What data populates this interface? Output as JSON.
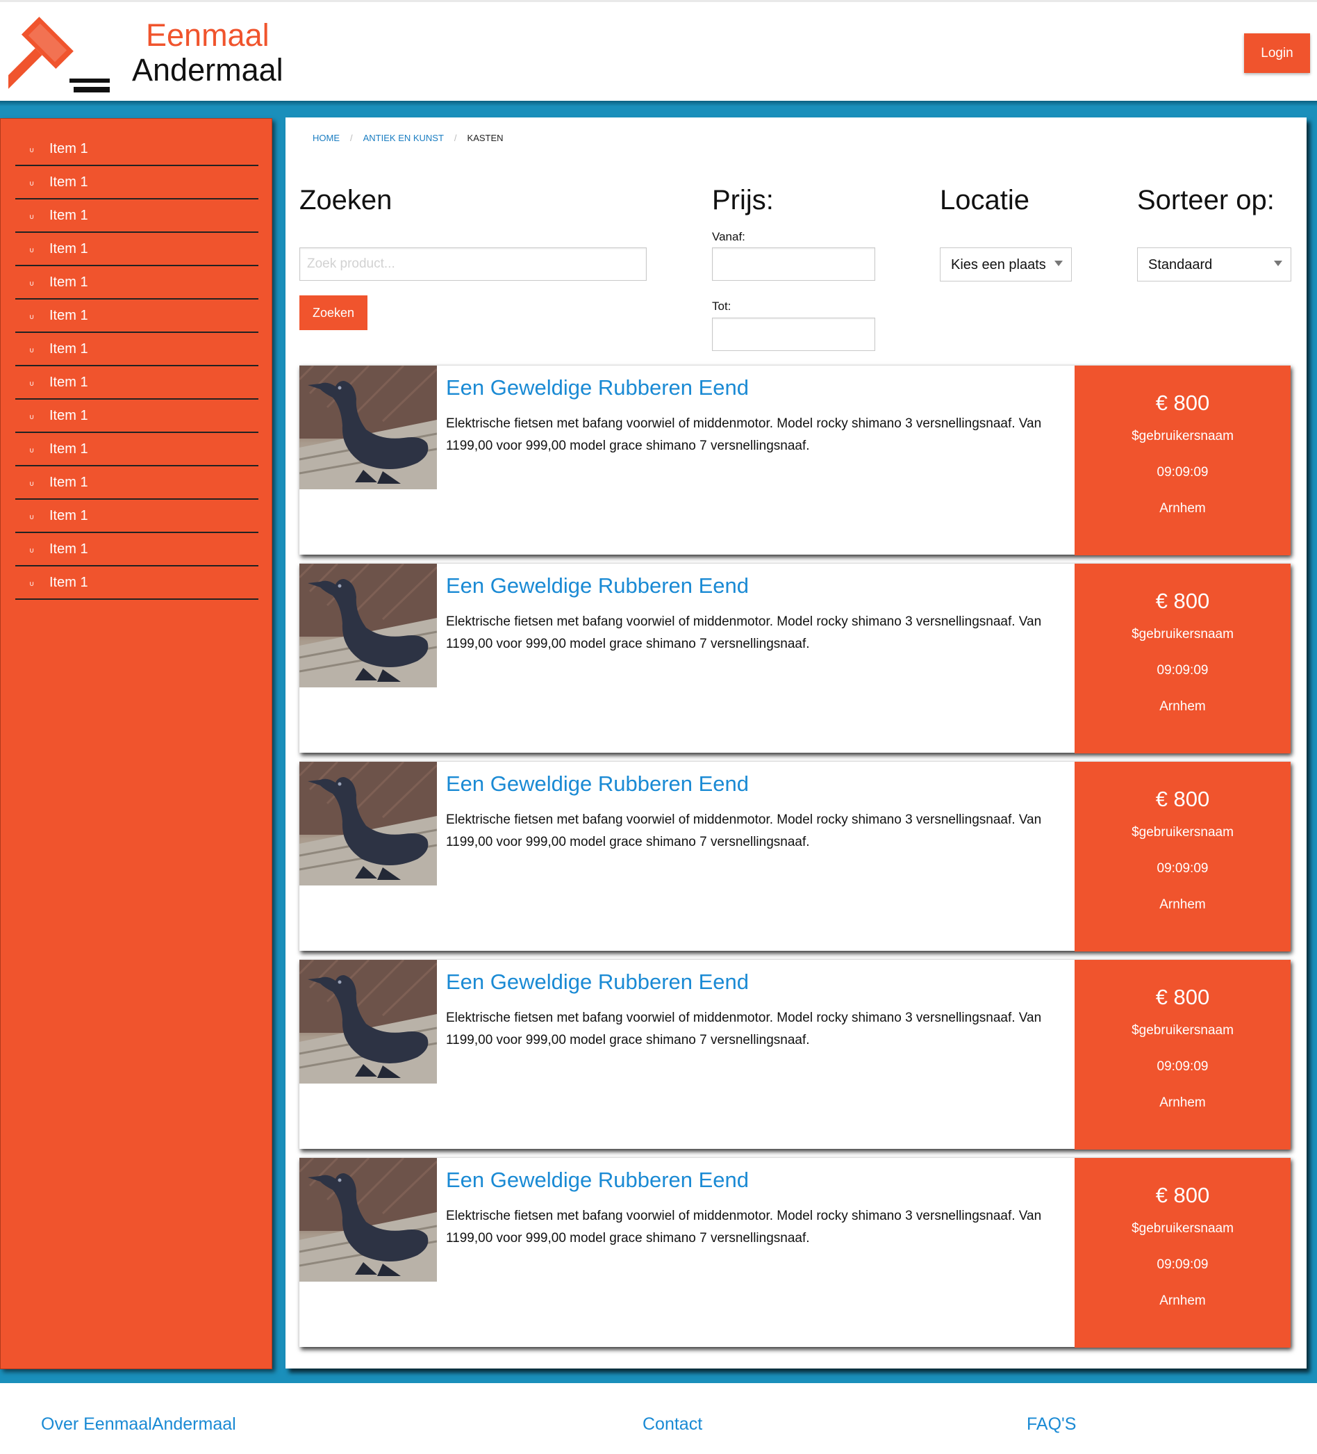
{
  "header": {
    "logo_line1": "Eenmaal",
    "logo_line2": "Andermaal",
    "login_label": "Login"
  },
  "colors": {
    "brand_orange": "#f0542d",
    "frame_blue": "#1a8fbb",
    "link_blue": "#1a8ad4"
  },
  "sidebar": {
    "items": [
      {
        "label": "Item 1"
      },
      {
        "label": "Item 1"
      },
      {
        "label": "Item 1"
      },
      {
        "label": "Item 1"
      },
      {
        "label": "Item 1"
      },
      {
        "label": "Item 1"
      },
      {
        "label": "Item 1"
      },
      {
        "label": "Item 1"
      },
      {
        "label": "Item 1"
      },
      {
        "label": "Item 1"
      },
      {
        "label": "Item 1"
      },
      {
        "label": "Item 1"
      },
      {
        "label": "Item 1"
      },
      {
        "label": "Item 1"
      }
    ]
  },
  "breadcrumb": {
    "home": "HOME",
    "category": "ANTIEK EN KUNST",
    "current": "KASTEN"
  },
  "filters": {
    "search_heading": "Zoeken",
    "search_placeholder": "Zoek product...",
    "search_button": "Zoeken",
    "price_heading": "Prijs:",
    "price_from_label": "Vanaf:",
    "price_to_label": "Tot:",
    "location_heading": "Locatie",
    "location_selected": "Kies een plaats",
    "sort_heading": "Sorteer op:",
    "sort_selected": "Standaard"
  },
  "listings": [
    {
      "title": "Een Geweldige Rubberen Eend",
      "description": "Elektrische fietsen met bafang voorwiel of middenmotor. Model rocky shimano 3 versnellingsnaaf. Van 1199,00 voor 999,00 model grace shimano 7 versnellingsnaaf.",
      "price": "€ 800",
      "user": "$gebruikersnaam",
      "time": "09:09:09",
      "location": "Arnhem"
    },
    {
      "title": "Een Geweldige Rubberen Eend",
      "description": "Elektrische fietsen met bafang voorwiel of middenmotor. Model rocky shimano 3 versnellingsnaaf. Van 1199,00 voor 999,00 model grace shimano 7 versnellingsnaaf.",
      "price": "€ 800",
      "user": "$gebruikersnaam",
      "time": "09:09:09",
      "location": "Arnhem"
    },
    {
      "title": "Een Geweldige Rubberen Eend",
      "description": "Elektrische fietsen met bafang voorwiel of middenmotor. Model rocky shimano 3 versnellingsnaaf. Van 1199,00 voor 999,00 model grace shimano 7 versnellingsnaaf.",
      "price": "€ 800",
      "user": "$gebruikersnaam",
      "time": "09:09:09",
      "location": "Arnhem"
    },
    {
      "title": "Een Geweldige Rubberen Eend",
      "description": "Elektrische fietsen met bafang voorwiel of middenmotor. Model rocky shimano 3 versnellingsnaaf. Van 1199,00 voor 999,00 model grace shimano 7 versnellingsnaaf.",
      "price": "€ 800",
      "user": "$gebruikersnaam",
      "time": "09:09:09",
      "location": "Arnhem"
    },
    {
      "title": "Een Geweldige Rubberen Eend",
      "description": "Elektrische fietsen met bafang voorwiel of middenmotor. Model rocky shimano 3 versnellingsnaaf. Van 1199,00 voor 999,00 model grace shimano 7 versnellingsnaaf.",
      "price": "€ 800",
      "user": "$gebruikersnaam",
      "time": "09:09:09",
      "location": "Arnhem"
    }
  ],
  "footer": {
    "about": "Over EenmaalAndermaal",
    "contact": "Contact",
    "faq": "FAQ'S"
  }
}
